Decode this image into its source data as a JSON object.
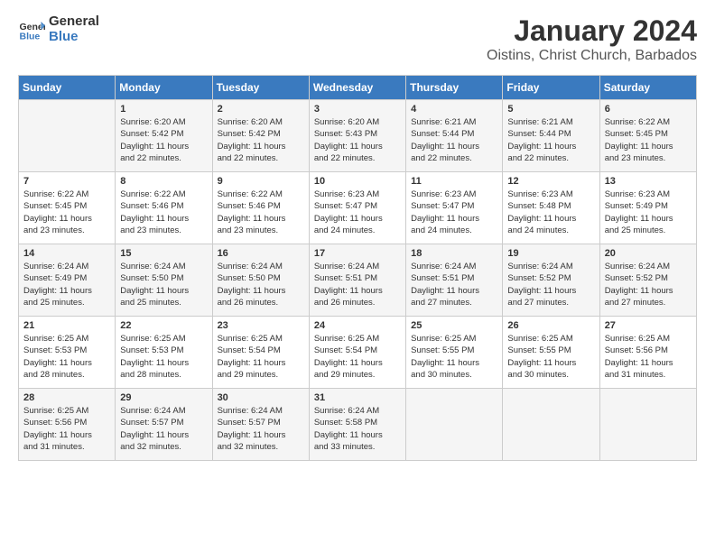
{
  "logo": {
    "text_general": "General",
    "text_blue": "Blue"
  },
  "title": "January 2024",
  "subtitle": "Oistins, Christ Church, Barbados",
  "days_of_week": [
    "Sunday",
    "Monday",
    "Tuesday",
    "Wednesday",
    "Thursday",
    "Friday",
    "Saturday"
  ],
  "weeks": [
    [
      {
        "day": "",
        "info": ""
      },
      {
        "day": "1",
        "info": "Sunrise: 6:20 AM\nSunset: 5:42 PM\nDaylight: 11 hours\nand 22 minutes."
      },
      {
        "day": "2",
        "info": "Sunrise: 6:20 AM\nSunset: 5:42 PM\nDaylight: 11 hours\nand 22 minutes."
      },
      {
        "day": "3",
        "info": "Sunrise: 6:20 AM\nSunset: 5:43 PM\nDaylight: 11 hours\nand 22 minutes."
      },
      {
        "day": "4",
        "info": "Sunrise: 6:21 AM\nSunset: 5:44 PM\nDaylight: 11 hours\nand 22 minutes."
      },
      {
        "day": "5",
        "info": "Sunrise: 6:21 AM\nSunset: 5:44 PM\nDaylight: 11 hours\nand 22 minutes."
      },
      {
        "day": "6",
        "info": "Sunrise: 6:22 AM\nSunset: 5:45 PM\nDaylight: 11 hours\nand 23 minutes."
      }
    ],
    [
      {
        "day": "7",
        "info": "Sunrise: 6:22 AM\nSunset: 5:45 PM\nDaylight: 11 hours\nand 23 minutes."
      },
      {
        "day": "8",
        "info": "Sunrise: 6:22 AM\nSunset: 5:46 PM\nDaylight: 11 hours\nand 23 minutes."
      },
      {
        "day": "9",
        "info": "Sunrise: 6:22 AM\nSunset: 5:46 PM\nDaylight: 11 hours\nand 23 minutes."
      },
      {
        "day": "10",
        "info": "Sunrise: 6:23 AM\nSunset: 5:47 PM\nDaylight: 11 hours\nand 24 minutes."
      },
      {
        "day": "11",
        "info": "Sunrise: 6:23 AM\nSunset: 5:47 PM\nDaylight: 11 hours\nand 24 minutes."
      },
      {
        "day": "12",
        "info": "Sunrise: 6:23 AM\nSunset: 5:48 PM\nDaylight: 11 hours\nand 24 minutes."
      },
      {
        "day": "13",
        "info": "Sunrise: 6:23 AM\nSunset: 5:49 PM\nDaylight: 11 hours\nand 25 minutes."
      }
    ],
    [
      {
        "day": "14",
        "info": "Sunrise: 6:24 AM\nSunset: 5:49 PM\nDaylight: 11 hours\nand 25 minutes."
      },
      {
        "day": "15",
        "info": "Sunrise: 6:24 AM\nSunset: 5:50 PM\nDaylight: 11 hours\nand 25 minutes."
      },
      {
        "day": "16",
        "info": "Sunrise: 6:24 AM\nSunset: 5:50 PM\nDaylight: 11 hours\nand 26 minutes."
      },
      {
        "day": "17",
        "info": "Sunrise: 6:24 AM\nSunset: 5:51 PM\nDaylight: 11 hours\nand 26 minutes."
      },
      {
        "day": "18",
        "info": "Sunrise: 6:24 AM\nSunset: 5:51 PM\nDaylight: 11 hours\nand 27 minutes."
      },
      {
        "day": "19",
        "info": "Sunrise: 6:24 AM\nSunset: 5:52 PM\nDaylight: 11 hours\nand 27 minutes."
      },
      {
        "day": "20",
        "info": "Sunrise: 6:24 AM\nSunset: 5:52 PM\nDaylight: 11 hours\nand 27 minutes."
      }
    ],
    [
      {
        "day": "21",
        "info": "Sunrise: 6:25 AM\nSunset: 5:53 PM\nDaylight: 11 hours\nand 28 minutes."
      },
      {
        "day": "22",
        "info": "Sunrise: 6:25 AM\nSunset: 5:53 PM\nDaylight: 11 hours\nand 28 minutes."
      },
      {
        "day": "23",
        "info": "Sunrise: 6:25 AM\nSunset: 5:54 PM\nDaylight: 11 hours\nand 29 minutes."
      },
      {
        "day": "24",
        "info": "Sunrise: 6:25 AM\nSunset: 5:54 PM\nDaylight: 11 hours\nand 29 minutes."
      },
      {
        "day": "25",
        "info": "Sunrise: 6:25 AM\nSunset: 5:55 PM\nDaylight: 11 hours\nand 30 minutes."
      },
      {
        "day": "26",
        "info": "Sunrise: 6:25 AM\nSunset: 5:55 PM\nDaylight: 11 hours\nand 30 minutes."
      },
      {
        "day": "27",
        "info": "Sunrise: 6:25 AM\nSunset: 5:56 PM\nDaylight: 11 hours\nand 31 minutes."
      }
    ],
    [
      {
        "day": "28",
        "info": "Sunrise: 6:25 AM\nSunset: 5:56 PM\nDaylight: 11 hours\nand 31 minutes."
      },
      {
        "day": "29",
        "info": "Sunrise: 6:24 AM\nSunset: 5:57 PM\nDaylight: 11 hours\nand 32 minutes."
      },
      {
        "day": "30",
        "info": "Sunrise: 6:24 AM\nSunset: 5:57 PM\nDaylight: 11 hours\nand 32 minutes."
      },
      {
        "day": "31",
        "info": "Sunrise: 6:24 AM\nSunset: 5:58 PM\nDaylight: 11 hours\nand 33 minutes."
      },
      {
        "day": "",
        "info": ""
      },
      {
        "day": "",
        "info": ""
      },
      {
        "day": "",
        "info": ""
      }
    ]
  ]
}
